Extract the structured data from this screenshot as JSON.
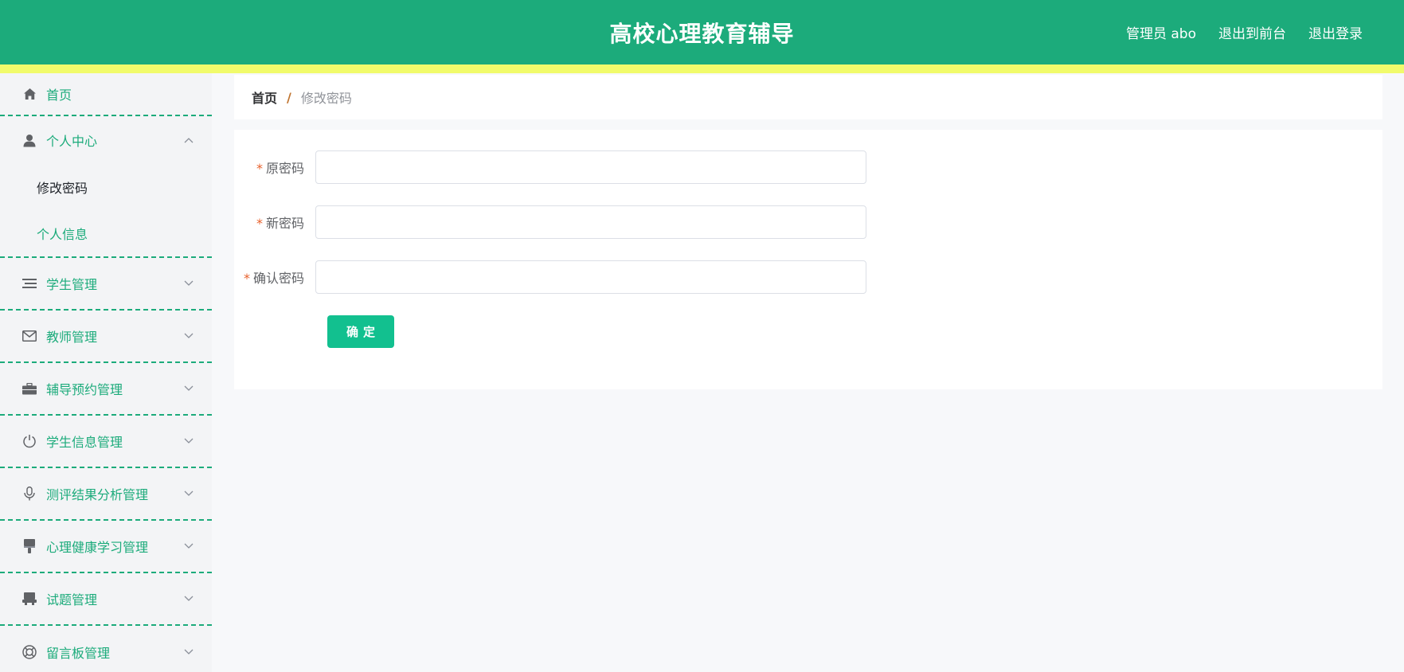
{
  "header": {
    "title": "高校心理教育辅导",
    "admin_label": "管理员 abo",
    "exit_front": "退出到前台",
    "logout": "退出登录",
    "colors": {
      "bar": "#1cab7b",
      "strip": "#f1fb6b"
    }
  },
  "sidebar": {
    "home": {
      "label": "首页",
      "icon": "home-icon"
    },
    "personal_center": {
      "label": "个人中心",
      "icon": "user-icon",
      "expanded": true,
      "children": [
        {
          "label": "修改密码",
          "active": true
        },
        {
          "label": "个人信息",
          "active": false
        }
      ]
    },
    "items": [
      {
        "label": "学生管理",
        "icon": "list-icon"
      },
      {
        "label": "教师管理",
        "icon": "mail-icon"
      },
      {
        "label": "辅导预约管理",
        "icon": "briefcase-icon"
      },
      {
        "label": "学生信息管理",
        "icon": "power-icon"
      },
      {
        "label": "测评结果分析管理",
        "icon": "microphone-icon"
      },
      {
        "label": "心理健康学习管理",
        "icon": "brush-icon"
      },
      {
        "label": "试题管理",
        "icon": "printer-icon"
      },
      {
        "label": "留言板管理",
        "icon": "lifebuoy-icon"
      }
    ]
  },
  "breadcrumb": {
    "home": "首页",
    "separator": "/",
    "current": "修改密码"
  },
  "form": {
    "fields": [
      {
        "label": "原密码",
        "required": "*",
        "value": ""
      },
      {
        "label": "新密码",
        "required": "*",
        "value": ""
      },
      {
        "label": "确认密码",
        "required": "*",
        "value": ""
      }
    ],
    "submit_label": "确定",
    "accent": "#12c08f"
  }
}
